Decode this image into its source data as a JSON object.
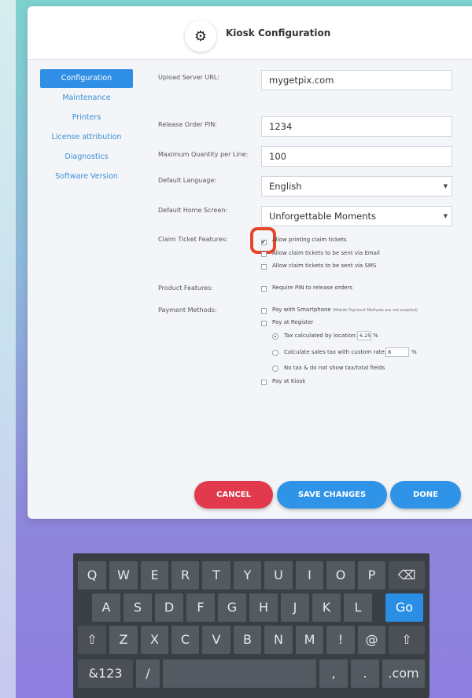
{
  "dialog": {
    "title": "Kiosk Configuration",
    "header_icon": "gear-icon"
  },
  "sidebar": {
    "items": [
      {
        "label": "Configuration",
        "active": true
      },
      {
        "label": "Maintenance",
        "active": false
      },
      {
        "label": "Printers",
        "active": false
      },
      {
        "label": "License attribution",
        "active": false
      },
      {
        "label": "Diagnostics",
        "active": false
      },
      {
        "label": "Software Version",
        "active": false
      }
    ]
  },
  "form": {
    "upload_url": {
      "label": "Upload Server URL:",
      "value": "mygetpix.com"
    },
    "release_pin": {
      "label": "Release Order PIN:",
      "value": "1234"
    },
    "max_qty": {
      "label": "Maximum Quantity per Line:",
      "value": "100"
    },
    "language": {
      "label": "Default Language:",
      "value": "English"
    },
    "home_screen": {
      "label": "Default Home Screen:",
      "value": "Unforgettable Moments"
    },
    "claim_ticket": {
      "label": "Claim Ticket Features:",
      "options": [
        {
          "label": "Allow printing claim tickets",
          "checked": true
        },
        {
          "label": "Allow claim tickets to be sent via Email",
          "checked": false
        },
        {
          "label": "Allow claim tickets to be sent via SMS",
          "checked": false
        }
      ]
    },
    "product_features": {
      "label": "Product Features:",
      "options": [
        {
          "label": "Require PIN to release orders",
          "checked": false
        }
      ]
    },
    "payment_methods": {
      "label": "Payment Methods:",
      "smartphone": {
        "label": "Pay with Smartphone",
        "note": "(Mobile Payment Methods are not enabled)",
        "checked": false
      },
      "register": {
        "label": "Pay at Register",
        "checked": false
      },
      "tax_location": {
        "label": "Tax calculated by location:",
        "value": "6.25",
        "unit": "%",
        "selected": true
      },
      "tax_custom": {
        "label": "Calculate sales tax with custom rate:",
        "value": "8",
        "unit": "%",
        "selected": false
      },
      "no_tax": {
        "label": "No tax & do not show tax/total fields",
        "selected": false
      },
      "kiosk": {
        "label": "Pay at Kiosk",
        "checked": false
      }
    }
  },
  "buttons": {
    "cancel": "CANCEL",
    "save": "SAVE CHANGES",
    "done": "DONE"
  },
  "keyboard": {
    "row1": [
      "Q",
      "W",
      "E",
      "R",
      "T",
      "Y",
      "U",
      "I",
      "O",
      "P",
      "⌫"
    ],
    "row2": [
      "A",
      "S",
      "D",
      "F",
      "G",
      "H",
      "J",
      "K",
      "L",
      "Go"
    ],
    "row3": [
      "⇧",
      "Z",
      "X",
      "C",
      "V",
      "B",
      "N",
      "M",
      "!",
      "@",
      "⇧"
    ],
    "row4": [
      "&123",
      "/",
      "",
      ",",
      ".",
      ".com"
    ]
  },
  "colors": {
    "accent": "#2f93e8",
    "cancel": "#e23a4c",
    "highlight": "#e5472b"
  }
}
